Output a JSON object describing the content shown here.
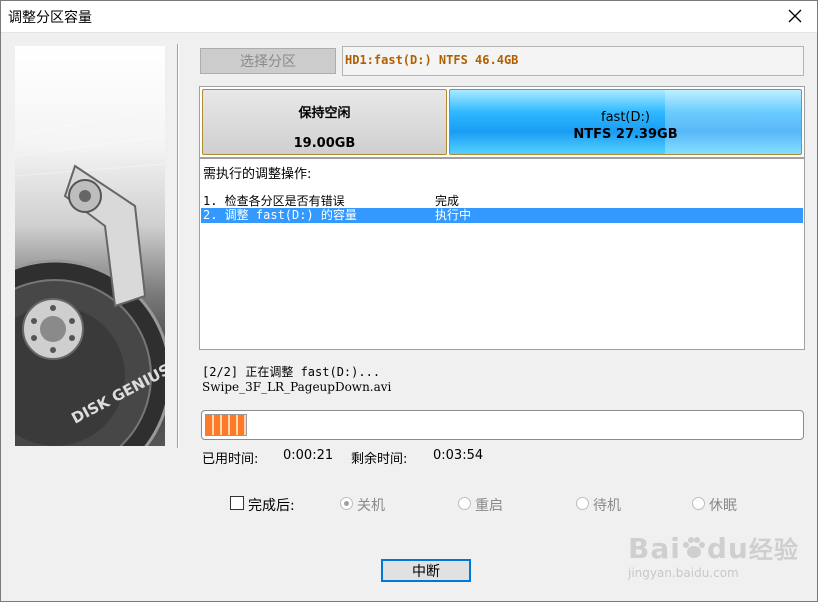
{
  "window": {
    "title": "调整分区容量"
  },
  "icons": {
    "close": "close-icon",
    "paw": "paw-icon",
    "disk": "hard-disk-image"
  },
  "side_image": {
    "brand_text": "DISK GENIUS"
  },
  "select_partition": {
    "label": "选择分区",
    "value": "HD1:fast(D:) NTFS 46.4GB"
  },
  "partition_map": {
    "free": {
      "label": "保持空闲",
      "size": "19.00GB"
    },
    "fast": {
      "name": "fast(D:)",
      "info": "NTFS 27.39GB"
    }
  },
  "operations": {
    "header": "需执行的调整操作:",
    "items": [
      {
        "text": "1. 检查各分区是否有错误",
        "status": "完成",
        "selected": false
      },
      {
        "text": "2. 调整 fast(D:) 的容量",
        "status": "执行中",
        "selected": true
      }
    ]
  },
  "status": {
    "line1": "[2/2] 正在调整 fast(D:)...",
    "line2": "Swipe_3F_LR_PageupDown.avi"
  },
  "progress": {
    "fraction": 0.07
  },
  "time": {
    "elapsed_label": "已用时间:",
    "elapsed": "0:00:21",
    "remaining_label": "剩余时间:",
    "remaining": "0:03:54"
  },
  "after_done": {
    "label": "完成后:",
    "checked": false,
    "options": [
      {
        "label": "关机",
        "selected": true
      },
      {
        "label": "重启",
        "selected": false
      },
      {
        "label": "待机",
        "selected": false
      },
      {
        "label": "休眠",
        "selected": false
      }
    ]
  },
  "buttons": {
    "stop": "中断"
  },
  "watermark": {
    "brand": "Bai",
    "brand2": "du",
    "cn": "经验",
    "url": "jingyan.baidu.com"
  },
  "colors": {
    "selection": "#3399ff",
    "progress": "#ff7a28",
    "partition_blue": "#1a9cf4",
    "value_text": "#b06000"
  }
}
